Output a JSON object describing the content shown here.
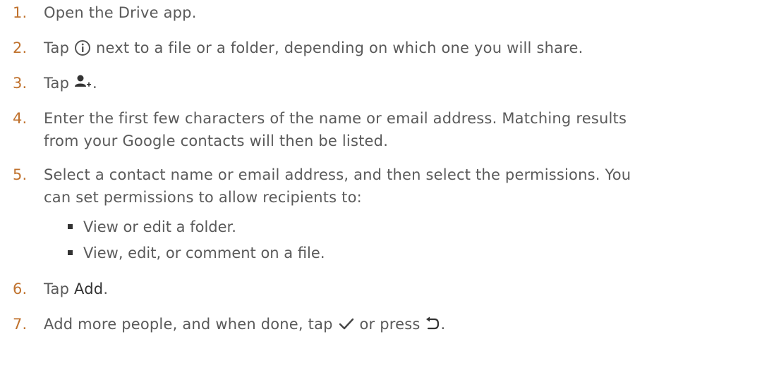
{
  "steps": [
    {
      "num": "1.",
      "text": "Open the Drive app."
    },
    {
      "num": "2.",
      "pre": "Tap",
      "post": "next to a file or a folder, depending on which one you will share.",
      "icon": "info-circle-icon"
    },
    {
      "num": "3.",
      "pre": "Tap",
      "post": ".",
      "icon": "add-person-icon"
    },
    {
      "num": "4.",
      "line1": "Enter the first few characters of the name or email address. Matching results",
      "line2": "from your Google contacts will then be listed."
    },
    {
      "num": "5.",
      "line1": "Select a contact name or email address, and then select the permissions. You",
      "line2": "can set permissions to allow recipients to:"
    },
    {
      "num": "6.",
      "pre": "Tap",
      "emph": "Add",
      "post": "."
    },
    {
      "num": "7.",
      "pre": "Add more people, and when done, tap",
      "mid": "or press",
      "post": ".",
      "icon1": "checkmark-icon",
      "icon2": "back-arrow-icon"
    }
  ],
  "bullets": [
    "View or edit a folder.",
    "View, edit, or comment on a file."
  ],
  "colors": {
    "step_number": "#c0722e",
    "body_text": "#5a5a5a",
    "bullet": "#333333"
  }
}
